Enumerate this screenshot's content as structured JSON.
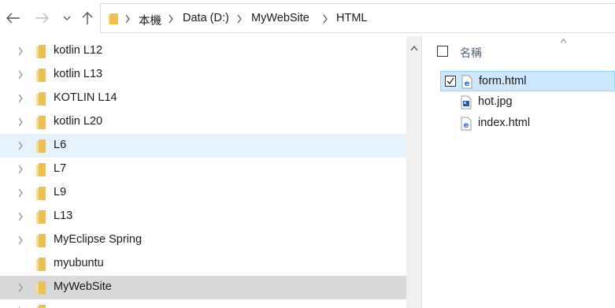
{
  "window": {
    "colors": {
      "hover": "#e5f3ff",
      "selected_tree": "#d9d9d9",
      "selected_file": "#cce8ff",
      "folder": "#f0c04c",
      "html_icon": "#1e6fd9"
    },
    "nav": {
      "back_icon": "arrow-left-icon",
      "forward_icon": "arrow-right-icon",
      "recent_icon": "chevron-down-icon",
      "up_icon": "arrow-up-icon"
    }
  },
  "address": {
    "crumbs": [
      "本機",
      "Data (D:)",
      "MyWebSite",
      "HTML"
    ]
  },
  "tree": {
    "items": [
      {
        "label": "kotlin L12",
        "expandable": true,
        "state": "normal"
      },
      {
        "label": "kotlin L13",
        "expandable": true,
        "state": "normal"
      },
      {
        "label": "KOTLIN L14",
        "expandable": true,
        "state": "normal"
      },
      {
        "label": "kotlin L20",
        "expandable": true,
        "state": "normal"
      },
      {
        "label": "L6",
        "expandable": true,
        "state": "hover"
      },
      {
        "label": "L7",
        "expandable": true,
        "state": "normal"
      },
      {
        "label": "L9",
        "expandable": true,
        "state": "normal"
      },
      {
        "label": "L13",
        "expandable": true,
        "state": "normal"
      },
      {
        "label": "MyEclipse Spring",
        "expandable": true,
        "state": "normal"
      },
      {
        "label": "myubuntu",
        "expandable": false,
        "state": "normal"
      },
      {
        "label": "MyWebSite",
        "expandable": true,
        "state": "selected"
      }
    ]
  },
  "filelist": {
    "header": {
      "name_label": "名稱"
    },
    "files": [
      {
        "name": "form.html",
        "icon": "html-file-icon",
        "selected": true,
        "checked": true
      },
      {
        "name": "hot.jpg",
        "icon": "image-file-icon",
        "selected": false,
        "checked": false
      },
      {
        "name": "index.html",
        "icon": "html-file-icon",
        "selected": false,
        "checked": false
      }
    ]
  }
}
